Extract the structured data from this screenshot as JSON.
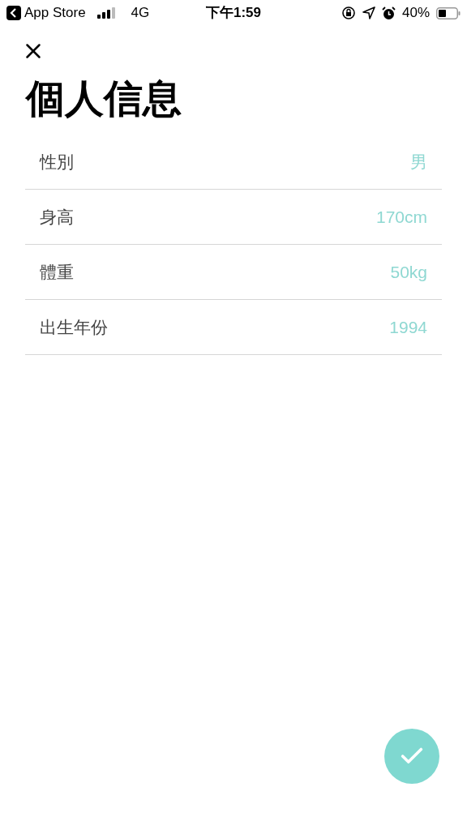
{
  "status_bar": {
    "back_app": "App Store",
    "network": "4G",
    "time": "下午1:59",
    "battery": "40%"
  },
  "title": "個人信息",
  "fields": [
    {
      "label": "性別",
      "value": "男"
    },
    {
      "label": "身高",
      "value": "170cm"
    },
    {
      "label": "體重",
      "value": "50kg"
    },
    {
      "label": "出生年份",
      "value": "1994"
    }
  ]
}
